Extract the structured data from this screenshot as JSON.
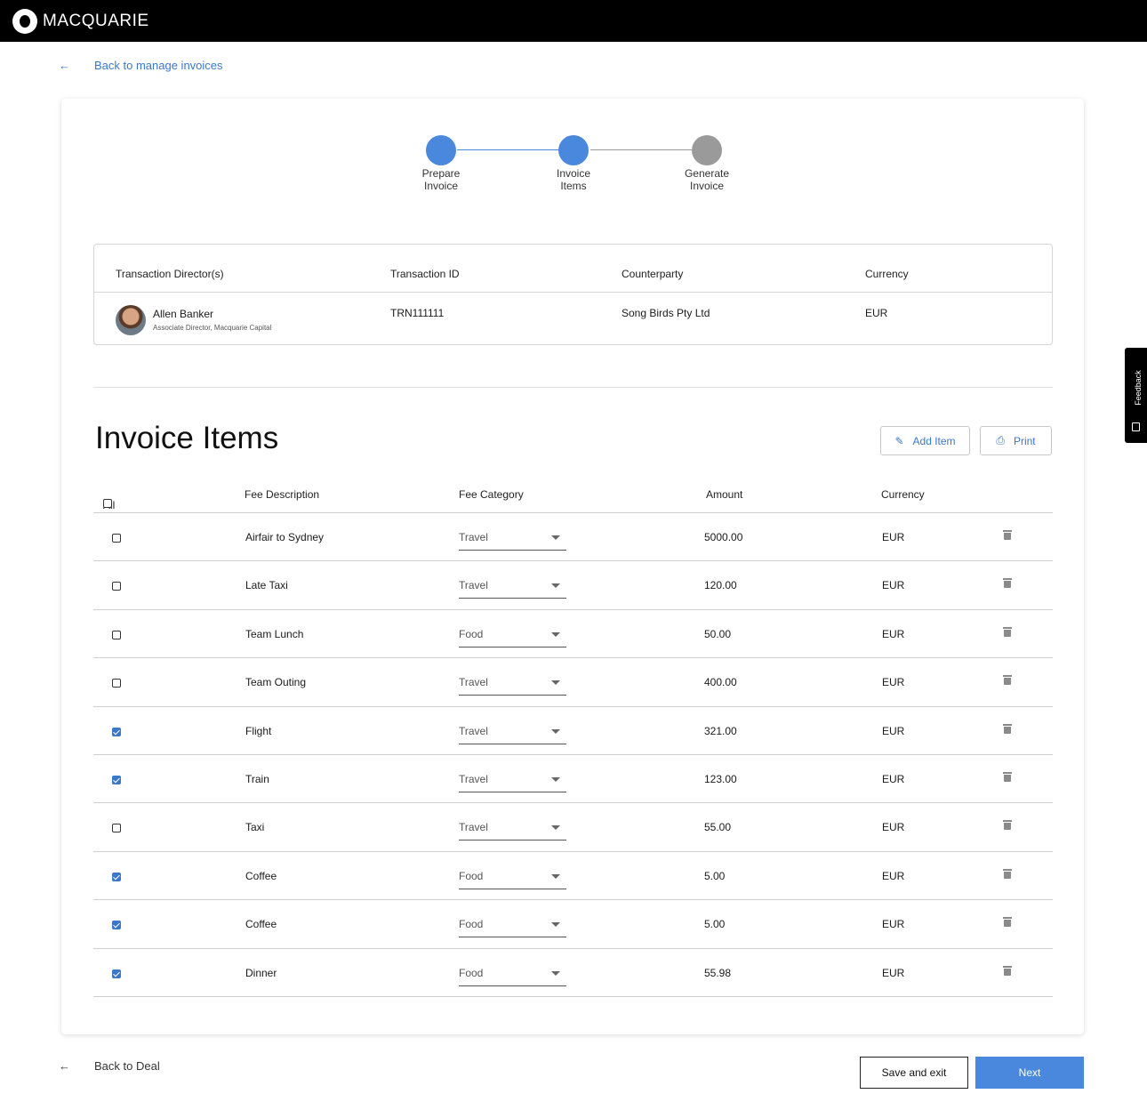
{
  "header": {
    "brand": "MACQUARIE"
  },
  "nav": {
    "back_label": "Back to manage invoices",
    "back_arrow": "←"
  },
  "stepper": [
    {
      "label": "Prepare\nInvoice",
      "state": "complete"
    },
    {
      "label": "Invoice\nItems",
      "state": "active"
    },
    {
      "label": "Generate\nInvoice",
      "state": "pending"
    }
  ],
  "transaction": {
    "headers": {
      "director": "Transaction Director(s)",
      "id": "Transaction ID",
      "counterparty": "Counterparty",
      "currency": "Currency"
    },
    "director_name": "Allen Banker",
    "director_role": "Associate Director, Macquarie Capital",
    "id": "TRN111111",
    "counterparty": "Song Birds Pty Ltd",
    "currency": "EUR"
  },
  "items_section": {
    "title": "Invoice Items",
    "add_label": "Add Item",
    "print_label": "Print",
    "columns": {
      "all": "All",
      "description": "Fee Description",
      "category": "Fee Category",
      "amount": "Amount",
      "currency": "Currency"
    }
  },
  "items": [
    {
      "checked": false,
      "description": "Airfair to Sydney",
      "category": "Travel",
      "amount": "5000.00",
      "currency": "EUR"
    },
    {
      "checked": false,
      "description": "Late Taxi",
      "category": "Travel",
      "amount": "120.00",
      "currency": "EUR"
    },
    {
      "checked": false,
      "description": "Team Lunch",
      "category": "Food",
      "amount": "50.00",
      "currency": "EUR"
    },
    {
      "checked": false,
      "description": "Team Outing",
      "category": "Travel",
      "amount": "400.00",
      "currency": "EUR"
    },
    {
      "checked": true,
      "description": "Flight",
      "category": "Travel",
      "amount": "321.00",
      "currency": "EUR"
    },
    {
      "checked": true,
      "description": "Train",
      "category": "Travel",
      "amount": "123.00",
      "currency": "EUR"
    },
    {
      "checked": false,
      "description": "Taxi",
      "category": "Travel",
      "amount": "55.00",
      "currency": "EUR"
    },
    {
      "checked": true,
      "description": "Coffee",
      "category": "Food",
      "amount": "5.00",
      "currency": "EUR"
    },
    {
      "checked": true,
      "description": "Coffee",
      "category": "Food",
      "amount": "5.00",
      "currency": "EUR"
    },
    {
      "checked": true,
      "description": "Dinner",
      "category": "Food",
      "amount": "55.98",
      "currency": "EUR"
    }
  ],
  "footer": {
    "back_label": "Back to Deal",
    "back_arrow": "←",
    "save_label": "Save and exit",
    "next_label": "Next"
  },
  "feedback": {
    "label": "Feedback"
  },
  "colors": {
    "accent": "#4a88dd",
    "link": "#3a78c9",
    "pending": "#9a9a9a",
    "header_bg": "#000000"
  },
  "icons": {
    "edit": "pencil-icon",
    "print": "printer-icon",
    "delete": "trash-icon",
    "feedback": "feedback-icon"
  }
}
